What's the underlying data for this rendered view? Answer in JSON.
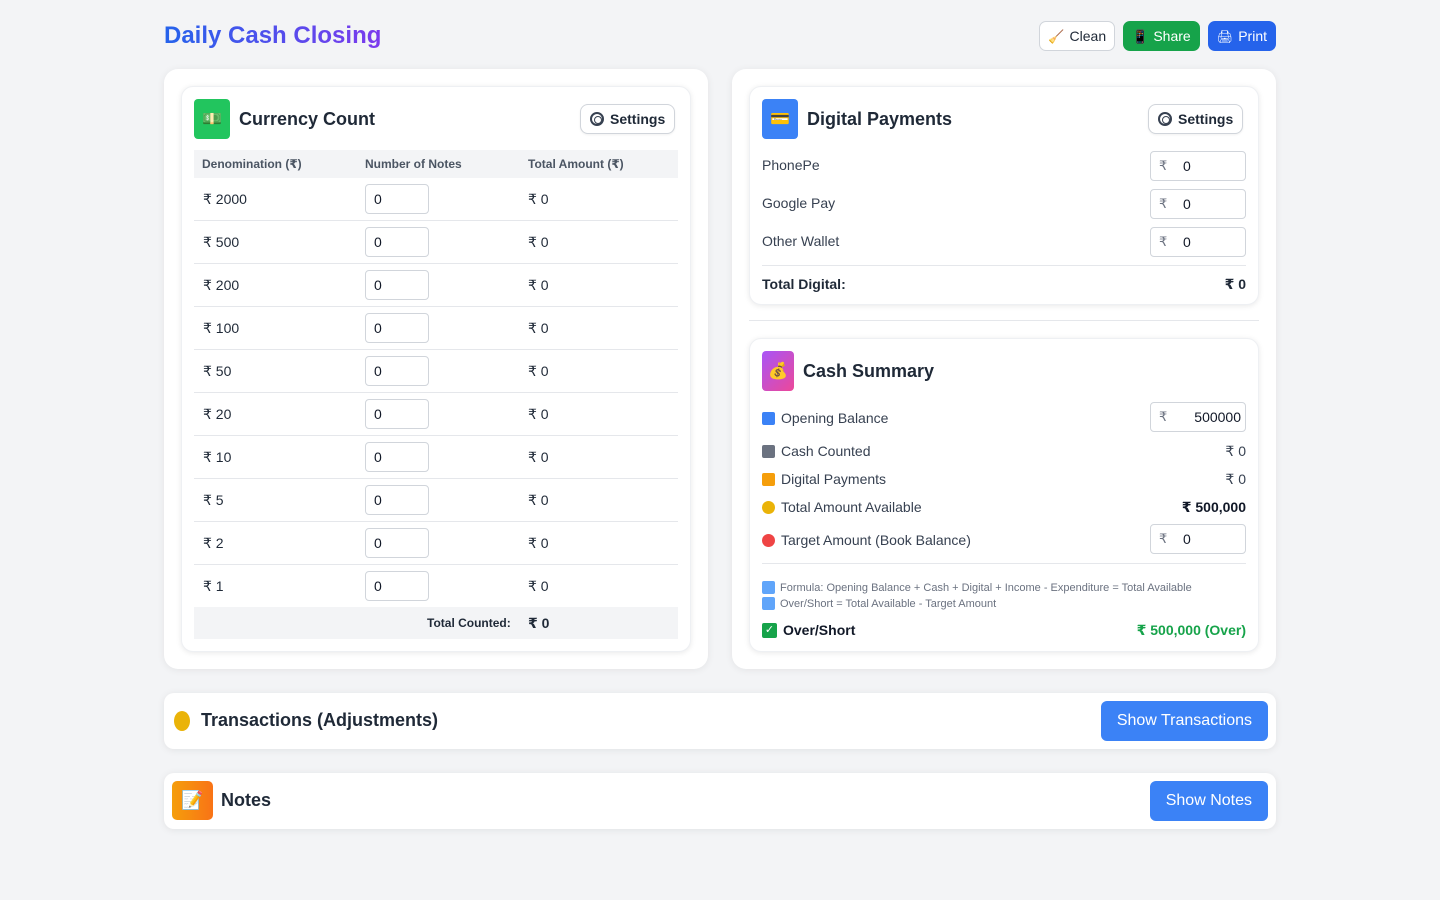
{
  "page": {
    "title": "Daily Cash Closing"
  },
  "toolbar": {
    "clean_label": "Clean",
    "share_label": "Share",
    "print_label": "Print"
  },
  "currency": {
    "title": "Currency Count",
    "settings_label": "Settings",
    "headers": {
      "denomination": "Denomination (₹)",
      "notes": "Number of Notes",
      "total": "Total Amount (₹)"
    },
    "rows": [
      {
        "denom": "₹ 2000",
        "notes": "0",
        "amount": "₹ 0"
      },
      {
        "denom": "₹ 500",
        "notes": "0",
        "amount": "₹ 0"
      },
      {
        "denom": "₹ 200",
        "notes": "0",
        "amount": "₹ 0"
      },
      {
        "denom": "₹ 100",
        "notes": "0",
        "amount": "₹ 0"
      },
      {
        "denom": "₹ 50",
        "notes": "0",
        "amount": "₹ 0"
      },
      {
        "denom": "₹ 20",
        "notes": "0",
        "amount": "₹ 0"
      },
      {
        "denom": "₹ 10",
        "notes": "0",
        "amount": "₹ 0"
      },
      {
        "denom": "₹ 5",
        "notes": "0",
        "amount": "₹ 0"
      },
      {
        "denom": "₹ 2",
        "notes": "0",
        "amount": "₹ 0"
      },
      {
        "denom": "₹ 1",
        "notes": "0",
        "amount": "₹ 0"
      }
    ],
    "total_label": "Total Counted:",
    "total_value": "₹ 0"
  },
  "digital": {
    "title": "Digital Payments",
    "settings_label": "Settings",
    "items": [
      {
        "label": "PhonePe",
        "value": "0"
      },
      {
        "label": "Google Pay",
        "value": "0"
      },
      {
        "label": "Other Wallet",
        "value": "0"
      }
    ],
    "currency_symbol": "₹",
    "total_label": "Total Digital:",
    "total_value": "₹ 0"
  },
  "summary": {
    "title": "Cash Summary",
    "opening_label": "Opening Balance",
    "opening_value": "500000",
    "cash_counted_label": "Cash Counted",
    "cash_counted_value": "₹ 0",
    "digital_label": "Digital Payments",
    "digital_value": "₹ 0",
    "total_available_label": "Total Amount Available",
    "total_available_value": "₹ 500,000",
    "target_label": "Target Amount (Book Balance)",
    "target_value": "0",
    "formula_1": "Formula: Opening Balance + Cash + Digital + Income - Expenditure = Total Available",
    "formula_2": "Over/Short = Total Available - Target Amount",
    "over_short_label": "Over/Short",
    "over_short_value": "₹ 500,000 (Over)",
    "colors": {
      "over": "#16a34a"
    }
  },
  "transactions": {
    "title": "Transactions (Adjustments)",
    "button_label": "Show Transactions"
  },
  "notes": {
    "title": "Notes",
    "button_label": "Show Notes"
  }
}
